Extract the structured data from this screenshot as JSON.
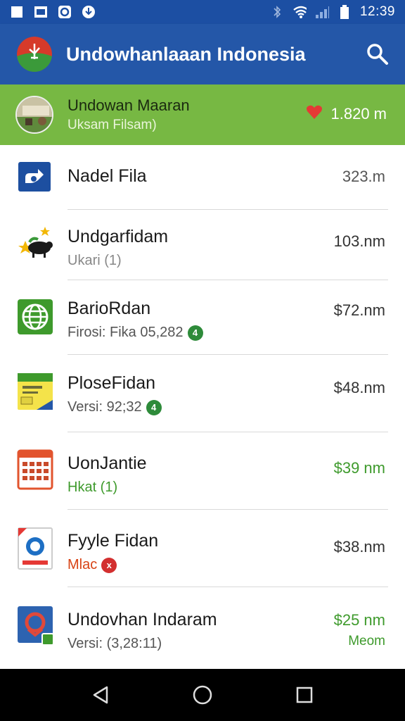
{
  "status_bar": {
    "time": "12:39",
    "left_icons": [
      "square-notification-icon",
      "image-notification-icon",
      "circle-notification-icon",
      "download-notification-icon"
    ],
    "right_icons": [
      "bluetooth-icon",
      "wifi-icon",
      "signal-icon",
      "battery-icon"
    ]
  },
  "app_bar": {
    "title": "Undowhanlaaan Indonesia",
    "logo": "app-logo-icon",
    "search_icon": "search-icon"
  },
  "highlight": {
    "title": "Undowan Maaran",
    "subtitle": "Uksam Filsam)",
    "distance": "1.820 m",
    "icon": "heart-icon"
  },
  "rows": [
    {
      "title": "Nadel Fila",
      "subtitle": "",
      "distance": "323.m",
      "extra": "",
      "icon": "blue-square-app-icon"
    },
    {
      "title": "Undgarfidam",
      "subtitle": "Ukari (1)",
      "distance": "103.nm",
      "extra": "",
      "icon": "animal-star-icon"
    },
    {
      "title": "BarioRdan",
      "subtitle": "Firosi: Fika 05,282",
      "distance": "$72.nm",
      "extra": "",
      "icon": "globe-icon",
      "badge": "4"
    },
    {
      "title": "PloseFidan",
      "subtitle": "Versi: 92;32",
      "distance": "$48.nm",
      "extra": "",
      "icon": "card-icon",
      "badge": "4"
    },
    {
      "title": "UonJantie",
      "subtitle": "Hkat (1)",
      "distance": "$39 nm",
      "extra": "",
      "icon": "calendar-icon"
    },
    {
      "title": "Fyyle Fidan",
      "subtitle": "Mlac",
      "distance": "$38.nm",
      "extra": "",
      "icon": "document-icon",
      "badge": "x"
    },
    {
      "title": "Undovhan Indaram",
      "subtitle": "Versi: (3,28:11)",
      "distance": "$25 nm",
      "extra": "Meom",
      "icon": "map-pin-app-icon"
    }
  ],
  "colors": {
    "primary": "#2457a8",
    "accent_green": "#77b843",
    "green_text": "#3e9a2c",
    "heart_red": "#e53935"
  },
  "nav": {
    "back": "back-icon",
    "home": "home-icon",
    "recents": "recents-icon"
  }
}
